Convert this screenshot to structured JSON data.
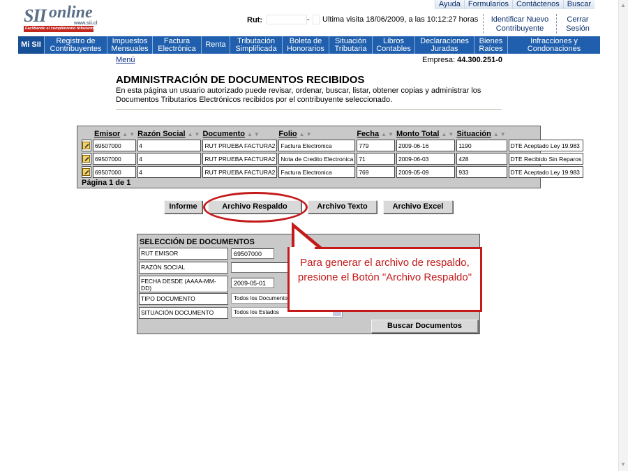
{
  "header": {
    "logo_text_sii": "SII",
    "logo_text_online": "online",
    "logo_url": "www.sii.cl",
    "logo_slogan": "Facilitando el cumplimiento tributario",
    "top_links": [
      "Ayuda",
      "Formularios",
      "Contáctenos",
      "Buscar"
    ],
    "rut_label": "Rut:",
    "rut_separator": "-",
    "last_visit": "Ultima visita 18/06/2009, a las 10:12:27 horas",
    "identify_link": "Identificar Nuevo Contribuyente",
    "logout_link": "Cerrar Sesión"
  },
  "nav": {
    "items": [
      "Mi SII",
      "Registro de Contribuyentes",
      "Impuestos Mensuales",
      "Factura Electrónica",
      "Renta",
      "Tributación Simplificada",
      "Boleta de Honorarios",
      "Situación Tributaria",
      "Libros Contables",
      "Declaraciones Juradas",
      "Bienes Raíces",
      "Infracciones y Condonaciones"
    ]
  },
  "page": {
    "menu_link": "Menú",
    "empresa_label": "Empresa:",
    "empresa_value": "44.300.251-0",
    "title": "ADMINISTRACIÓN DE DOCUMENTOS RECIBIDOS",
    "description": "En esta página un usuario autorizado puede revisar, ordenar, buscar, listar, obtener copias y administrar los Documentos Tributarios Electrónicos recibidos por el contribuyente seleccionado."
  },
  "grid": {
    "columns": [
      "Emisor",
      "Razón Social",
      "Documento",
      "Folio",
      "Fecha",
      "Monto Total",
      "Situación"
    ],
    "active_sort_column": "Fecha",
    "rows": [
      {
        "emisor": "69507000",
        "dv": "4",
        "razon": "RUT PRUEBA FACTURA2",
        "documento": "Factura Electronica",
        "folio": "779",
        "fecha": "2009-06-16",
        "monto": "1190",
        "situacion": "DTE Aceptado Ley 19.983"
      },
      {
        "emisor": "69507000",
        "dv": "4",
        "razon": "RUT PRUEBA FACTURA2",
        "documento": "Nota de Credito Electronica",
        "folio": "71",
        "fecha": "2009-06-03",
        "monto": "428",
        "situacion": "DTE Recibido Sin Reparos"
      },
      {
        "emisor": "69507000",
        "dv": "4",
        "razon": "RUT PRUEBA FACTURA2",
        "documento": "Factura Electronica",
        "folio": "769",
        "fecha": "2009-05-09",
        "monto": "933",
        "situacion": "DTE Aceptado Ley 19.983"
      }
    ],
    "pager": "Página 1 de 1"
  },
  "buttons": {
    "informe": "Informe",
    "archivo_respaldo": "Archivo Respaldo",
    "archivo_texto": "Archivo Texto",
    "archivo_excel": "Archivo Excel"
  },
  "form": {
    "title": "SELECCIÓN DE DOCUMENTOS",
    "rut_emisor_label": "RUT EMISOR",
    "rut_emisor_value": "69507000",
    "razon_social_label": "RAZÓN SOCIAL",
    "razon_social_value": "",
    "fecha_desde_label": "FECHA DESDE (AAAA-MM-DD)",
    "fecha_desde_value": "2009-05-01",
    "tipo_documento_label": "TIPO DOCUMENTO",
    "tipo_documento_value": "Todos los Documentos",
    "situacion_label": "SITUACIÓN DOCUMENTO",
    "situacion_value": "Todos los Estados",
    "search_button": "Buscar Documentos"
  },
  "annotation": {
    "callout_text": "Para generar el archivo de respaldo, presione el Botón \"Archivo Respaldo\"",
    "accent_color": "#c41a1a"
  }
}
